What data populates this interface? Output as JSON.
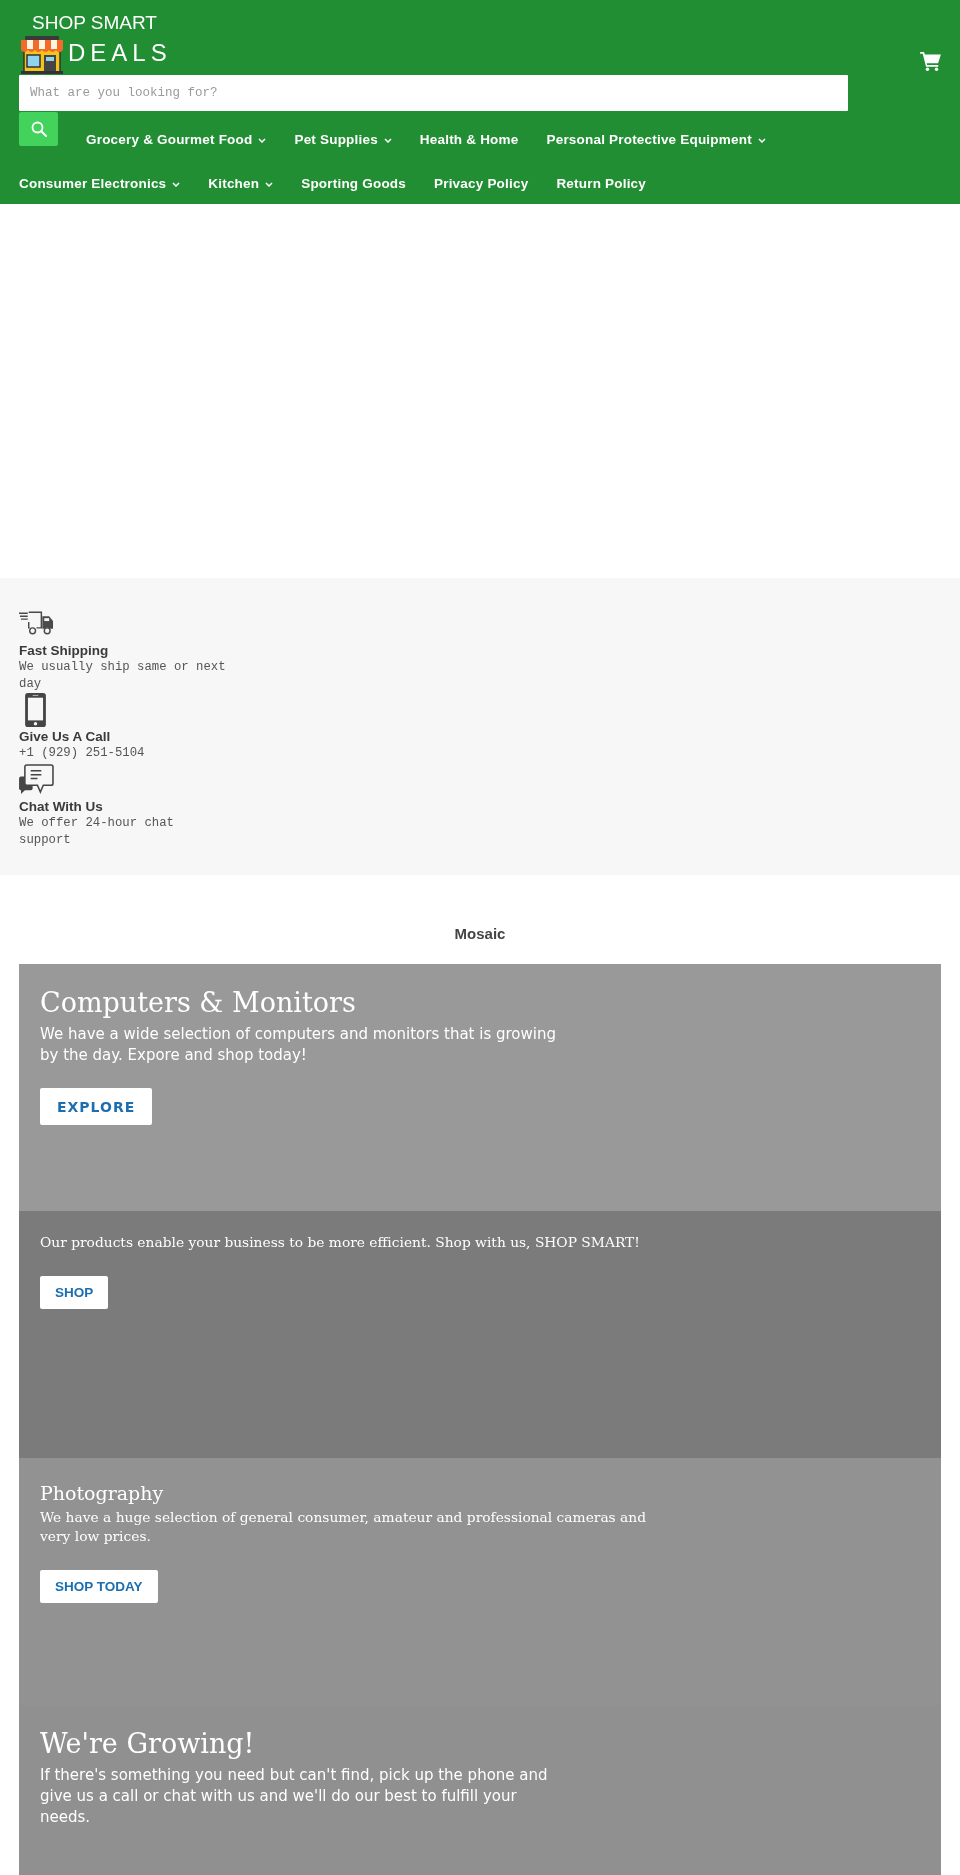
{
  "header": {
    "logo": {
      "line_1": "SHOP SMART",
      "line_2": "DEALS"
    },
    "search": {
      "placeholder": "What are you looking for?"
    },
    "nav": [
      {
        "label": "Grocery & Gourmet Food",
        "has_menu": true
      },
      {
        "label": "Pet Supplies",
        "has_menu": true
      },
      {
        "label": "Health & Home",
        "has_menu": false
      },
      {
        "label": "Personal Protective Equipment",
        "has_menu": true
      },
      {
        "label": "Consumer Electronics",
        "has_menu": true
      },
      {
        "label": "Kitchen",
        "has_menu": true
      },
      {
        "label": "Sporting Goods",
        "has_menu": false
      },
      {
        "label": "Privacy Policy",
        "has_menu": false
      },
      {
        "label": "Return Policy",
        "has_menu": false
      }
    ]
  },
  "features": [
    {
      "title": "Fast Shipping",
      "text": "We usually ship same or next day"
    },
    {
      "title": "Give Us A Call",
      "text": "+1 (929) 251-5104"
    },
    {
      "title": "Chat With Us",
      "text": "We offer 24-hour chat support"
    }
  ],
  "mosaic": {
    "title": "Mosaic",
    "tiles": [
      {
        "kind": "large",
        "color": "#989998",
        "title": "Computers & Monitors",
        "text": "We have a wide selection of computers and monitors that is growing by the day. Expore and shop today!",
        "button": "EXPLORE"
      },
      {
        "kind": "compact",
        "color": "#7a7b7a",
        "text": "Our products enable your business to be more efficient. Shop with us, SHOP SMART!",
        "button": "SHOP"
      },
      {
        "kind": "compact",
        "color": "#929292",
        "title": "Photography",
        "text": "We have a huge selection of general consumer, amateur and professional cameras and very low prices.",
        "button": "SHOP TODAY"
      },
      {
        "kind": "large",
        "color": "#8f908f",
        "title": "We're Growing!",
        "text": "If there's something you need but can't find, pick up the phone and give us a call or chat with us and we'll do our best to fulfill your needs."
      }
    ]
  }
}
